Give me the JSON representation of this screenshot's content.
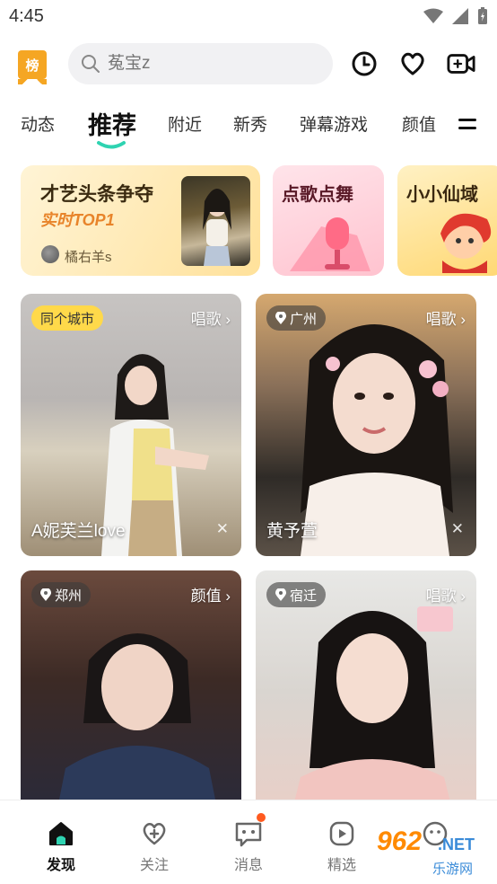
{
  "status_bar": {
    "time": "4:45"
  },
  "header": {
    "rank_badge": "榜",
    "search_placeholder": "菟宝z",
    "icons": [
      "history-icon",
      "favorite-icon",
      "live-video-icon"
    ]
  },
  "tabs": [
    {
      "label": "动态"
    },
    {
      "label": "推荐",
      "active": true
    },
    {
      "label": "附近"
    },
    {
      "label": "新秀"
    },
    {
      "label": "弹幕游戏"
    },
    {
      "label": "颜值"
    }
  ],
  "banners": [
    {
      "title": "才艺头条争夺",
      "subtitle": "实时TOP1",
      "user": "橘右羊s"
    },
    {
      "title": "点歌点舞"
    },
    {
      "title": "小小仙域"
    }
  ],
  "cards": [
    {
      "tag": "同个城市",
      "category": "唱歌",
      "name": "A妮芙兰love"
    },
    {
      "tag": "广州",
      "category": "唱歌",
      "name": "黄予萱"
    },
    {
      "tag": "郑州",
      "category": "颜值",
      "name": ""
    },
    {
      "tag": "宿迁",
      "category": "唱歌",
      "name": ""
    }
  ],
  "bottom_nav": [
    {
      "label": "发现",
      "active": true
    },
    {
      "label": "关注"
    },
    {
      "label": "消息",
      "badge": true
    },
    {
      "label": "精选"
    }
  ],
  "watermark": {
    "number": "962",
    "suffix": ".NET",
    "text": "乐游网"
  },
  "colors": {
    "accent": "#2fd3b1",
    "badge_orange": "#f5a623",
    "notify_dot": "#ff5a1f"
  }
}
